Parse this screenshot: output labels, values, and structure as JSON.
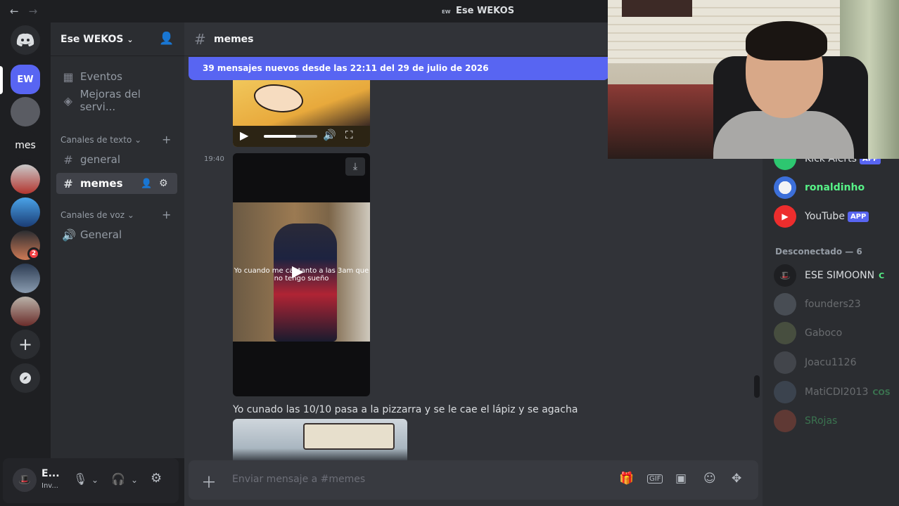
{
  "window": {
    "title": "Ese WEKOS",
    "nav_back": "←",
    "nav_forward": "→"
  },
  "guilds": {
    "home_icon": "discord-logo-icon",
    "items": [
      {
        "label": "EW",
        "color": "#5865f2"
      },
      {
        "label": "",
        "color": "#5a5c63"
      },
      {
        "label": "mes",
        "color": "#1e1f22"
      },
      {
        "label": "",
        "color": "#b3342e"
      },
      {
        "label": "",
        "color": "#2f6fb7"
      },
      {
        "label": "",
        "color": "#cf7a55",
        "badge": "2"
      },
      {
        "label": "",
        "color": "#2c3b52"
      },
      {
        "label": "",
        "color": "#6b2d2a"
      }
    ],
    "add_label": "+",
    "discover_icon": "compass-icon"
  },
  "server": {
    "name": "Ese WEKOS",
    "events_label": "Eventos",
    "boosts_label": "Mejoras del servi...",
    "text_category": "Canales de texto",
    "text_channels": [
      "general",
      "memes"
    ],
    "voice_category": "Canales de voz",
    "voice_channels": [
      "General"
    ]
  },
  "user": {
    "name": "E...",
    "status": "Inv..."
  },
  "chat": {
    "channel": "memes",
    "new_messages": "39 mensajes nuevos desde las 22:11 del 29 de julio de 2026",
    "timestamp": "19:40",
    "video_caption": "Yo cuando me cantanto a las 3am que no tengo sueño",
    "message_text": "Yo cunado las 10/10 pasa a la pizzarra y se le cae el lápiz y se agacha",
    "composer_placeholder": "Enviar mensaje a #memes"
  },
  "members": {
    "online": [
      {
        "name": "Kick Alerts",
        "color": "#2dc770",
        "tag": "APP"
      },
      {
        "name": "ronaldinho",
        "color": "#57f287",
        "tag": ""
      },
      {
        "name": "YouTube",
        "color": "#ed2d2d",
        "tag": "APP"
      }
    ],
    "offline_header": "Desconectado — 6",
    "offline": [
      {
        "name": "ESE SIMOONN",
        "extra": "C"
      },
      {
        "name": "founders23",
        "extra": ""
      },
      {
        "name": "Gaboco",
        "extra": ""
      },
      {
        "name": "Joacu1126",
        "extra": ""
      },
      {
        "name": "MatiCDI2013",
        "extra": "COS"
      },
      {
        "name": "SRojas",
        "extra": ""
      }
    ]
  },
  "colors": {
    "accent": "#5865f2",
    "background": "#313338",
    "sidebar": "#2b2d31"
  }
}
